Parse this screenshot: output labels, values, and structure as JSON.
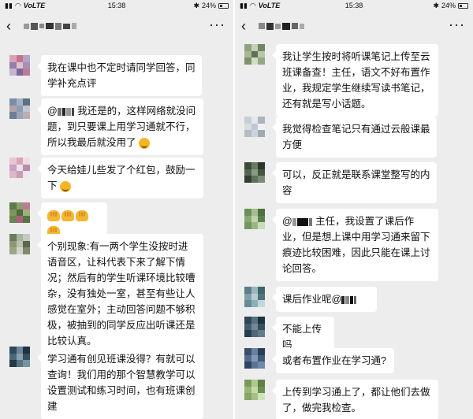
{
  "status_bar": {
    "carrier": "VoLTE",
    "time": "15:38",
    "battery": "24%"
  },
  "header": {
    "more_label": "···"
  },
  "left_messages": [
    {
      "text": "我在课中也不定时请同学回答，同学补充点评"
    },
    {
      "mention": "@",
      "text": " 我还是的，这样网络就没问题，到只要课上用学习通就不行，所以我最后就没用了"
    },
    {
      "text": "今天给娃儿些发了个红包，鼓励一下"
    },
    {
      "text": ""
    },
    {
      "text": "个别现象:有一两个学生没按时进语音区，让科代表下来了解下情况；然后有的学生听课环境比较嘈杂，没有独处一室，甚至有些让人感觉在室外；主动回答问题不够积极，被抽到的同学反应出听课还是比较认真。"
    },
    {
      "text": "学习通有创见班课没得？有就可以查询！我们用的那个智慧教学可以设置测试和练习时间，也有班课创建"
    }
  ],
  "right_messages": [
    {
      "text": "我让学生按时将听课笔记上传至云班课备查！主任，语文不好布置作业，我规定学生继续写读书笔记，还有就是写小话题。"
    },
    {
      "text": "我觉得检查笔记只有通过云般课最方便"
    },
    {
      "text": "可以，反正就是联系课堂整写的内容"
    },
    {
      "mention": "@",
      "text": " 主任，我设置了课后作业，但是想上课中用学习通来留下痕迹比较困难，因此只能在课上讨论回答。"
    },
    {
      "text": "课后作业呢@"
    },
    {
      "text": "不能上传吗"
    },
    {
      "text": "或者布置作业在学习通?"
    },
    {
      "text": "上传到学习通上了，都让他们去做了，做完我检查。"
    }
  ],
  "colors": {
    "chat_bg": "#ededed",
    "bubble": "#ffffff"
  }
}
